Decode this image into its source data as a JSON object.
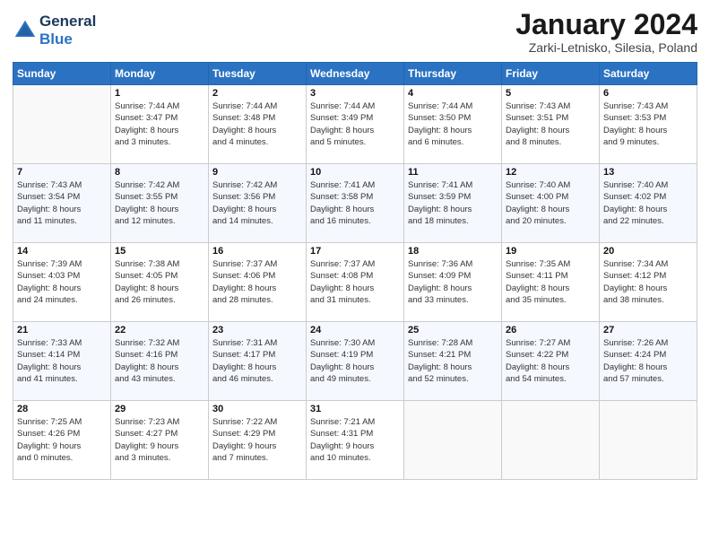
{
  "header": {
    "logo": {
      "line1": "General",
      "line2": "Blue"
    },
    "title": "January 2024",
    "subtitle": "Zarki-Letnisko, Silesia, Poland"
  },
  "weekdays": [
    "Sunday",
    "Monday",
    "Tuesday",
    "Wednesday",
    "Thursday",
    "Friday",
    "Saturday"
  ],
  "weeks": [
    [
      {
        "day": "",
        "info": ""
      },
      {
        "day": "1",
        "info": "Sunrise: 7:44 AM\nSunset: 3:47 PM\nDaylight: 8 hours\nand 3 minutes."
      },
      {
        "day": "2",
        "info": "Sunrise: 7:44 AM\nSunset: 3:48 PM\nDaylight: 8 hours\nand 4 minutes."
      },
      {
        "day": "3",
        "info": "Sunrise: 7:44 AM\nSunset: 3:49 PM\nDaylight: 8 hours\nand 5 minutes."
      },
      {
        "day": "4",
        "info": "Sunrise: 7:44 AM\nSunset: 3:50 PM\nDaylight: 8 hours\nand 6 minutes."
      },
      {
        "day": "5",
        "info": "Sunrise: 7:43 AM\nSunset: 3:51 PM\nDaylight: 8 hours\nand 8 minutes."
      },
      {
        "day": "6",
        "info": "Sunrise: 7:43 AM\nSunset: 3:53 PM\nDaylight: 8 hours\nand 9 minutes."
      }
    ],
    [
      {
        "day": "7",
        "info": "Sunrise: 7:43 AM\nSunset: 3:54 PM\nDaylight: 8 hours\nand 11 minutes."
      },
      {
        "day": "8",
        "info": "Sunrise: 7:42 AM\nSunset: 3:55 PM\nDaylight: 8 hours\nand 12 minutes."
      },
      {
        "day": "9",
        "info": "Sunrise: 7:42 AM\nSunset: 3:56 PM\nDaylight: 8 hours\nand 14 minutes."
      },
      {
        "day": "10",
        "info": "Sunrise: 7:41 AM\nSunset: 3:58 PM\nDaylight: 8 hours\nand 16 minutes."
      },
      {
        "day": "11",
        "info": "Sunrise: 7:41 AM\nSunset: 3:59 PM\nDaylight: 8 hours\nand 18 minutes."
      },
      {
        "day": "12",
        "info": "Sunrise: 7:40 AM\nSunset: 4:00 PM\nDaylight: 8 hours\nand 20 minutes."
      },
      {
        "day": "13",
        "info": "Sunrise: 7:40 AM\nSunset: 4:02 PM\nDaylight: 8 hours\nand 22 minutes."
      }
    ],
    [
      {
        "day": "14",
        "info": "Sunrise: 7:39 AM\nSunset: 4:03 PM\nDaylight: 8 hours\nand 24 minutes."
      },
      {
        "day": "15",
        "info": "Sunrise: 7:38 AM\nSunset: 4:05 PM\nDaylight: 8 hours\nand 26 minutes."
      },
      {
        "day": "16",
        "info": "Sunrise: 7:37 AM\nSunset: 4:06 PM\nDaylight: 8 hours\nand 28 minutes."
      },
      {
        "day": "17",
        "info": "Sunrise: 7:37 AM\nSunset: 4:08 PM\nDaylight: 8 hours\nand 31 minutes."
      },
      {
        "day": "18",
        "info": "Sunrise: 7:36 AM\nSunset: 4:09 PM\nDaylight: 8 hours\nand 33 minutes."
      },
      {
        "day": "19",
        "info": "Sunrise: 7:35 AM\nSunset: 4:11 PM\nDaylight: 8 hours\nand 35 minutes."
      },
      {
        "day": "20",
        "info": "Sunrise: 7:34 AM\nSunset: 4:12 PM\nDaylight: 8 hours\nand 38 minutes."
      }
    ],
    [
      {
        "day": "21",
        "info": "Sunrise: 7:33 AM\nSunset: 4:14 PM\nDaylight: 8 hours\nand 41 minutes."
      },
      {
        "day": "22",
        "info": "Sunrise: 7:32 AM\nSunset: 4:16 PM\nDaylight: 8 hours\nand 43 minutes."
      },
      {
        "day": "23",
        "info": "Sunrise: 7:31 AM\nSunset: 4:17 PM\nDaylight: 8 hours\nand 46 minutes."
      },
      {
        "day": "24",
        "info": "Sunrise: 7:30 AM\nSunset: 4:19 PM\nDaylight: 8 hours\nand 49 minutes."
      },
      {
        "day": "25",
        "info": "Sunrise: 7:28 AM\nSunset: 4:21 PM\nDaylight: 8 hours\nand 52 minutes."
      },
      {
        "day": "26",
        "info": "Sunrise: 7:27 AM\nSunset: 4:22 PM\nDaylight: 8 hours\nand 54 minutes."
      },
      {
        "day": "27",
        "info": "Sunrise: 7:26 AM\nSunset: 4:24 PM\nDaylight: 8 hours\nand 57 minutes."
      }
    ],
    [
      {
        "day": "28",
        "info": "Sunrise: 7:25 AM\nSunset: 4:26 PM\nDaylight: 9 hours\nand 0 minutes."
      },
      {
        "day": "29",
        "info": "Sunrise: 7:23 AM\nSunset: 4:27 PM\nDaylight: 9 hours\nand 3 minutes."
      },
      {
        "day": "30",
        "info": "Sunrise: 7:22 AM\nSunset: 4:29 PM\nDaylight: 9 hours\nand 7 minutes."
      },
      {
        "day": "31",
        "info": "Sunrise: 7:21 AM\nSunset: 4:31 PM\nDaylight: 9 hours\nand 10 minutes."
      },
      {
        "day": "",
        "info": ""
      },
      {
        "day": "",
        "info": ""
      },
      {
        "day": "",
        "info": ""
      }
    ]
  ]
}
